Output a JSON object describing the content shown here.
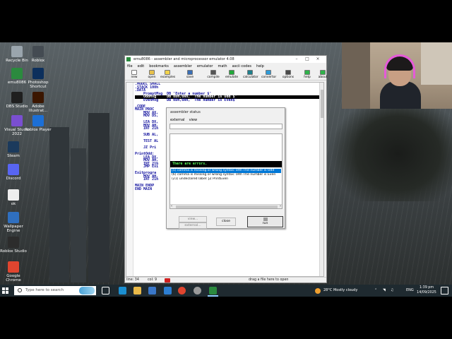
{
  "desktop_icons": [
    {
      "label": "Recycle Bin",
      "icon": "recycle-bin-icon",
      "color": "#9aa5ad"
    },
    {
      "label": "Roblox",
      "icon": "roblox-icon",
      "color": "#444b52"
    },
    {
      "label": "emu8086",
      "icon": "emu8086-icon",
      "color": "#2b8a3e"
    },
    {
      "label": "Photoshop Shortcut",
      "icon": "photoshop-icon",
      "color": "#0c2f5c"
    },
    {
      "label": "DBS Studio",
      "icon": "dbs-studio-icon",
      "color": "#1f1f1f"
    },
    {
      "label": "Adobe Illustrat...",
      "icon": "illustrator-icon",
      "color": "#3b1600"
    },
    {
      "label": "Visual Studio 2022",
      "icon": "visual-studio-icon",
      "color": "#7a4fd1"
    },
    {
      "label": "Roblox Player",
      "icon": "roblox-player-icon",
      "color": "#1c6fd6"
    },
    {
      "label": "Steam",
      "icon": "steam-icon",
      "color": "#1b3a5c"
    },
    {
      "label": "Discord",
      "icon": "discord-icon",
      "color": "#5865f2"
    },
    {
      "label": "ok",
      "icon": "file-icon",
      "color": "#eeeeee"
    },
    {
      "label": "Wallpaper Engine",
      "icon": "wallpaper-engine-icon",
      "color": "#2f6fbf"
    },
    {
      "label": "Roblox Studio",
      "icon": "roblox-studio-icon",
      "color": "#2c2c2c"
    },
    {
      "label": "Google Chrome",
      "icon": "chrome-icon",
      "color": "#e0452f"
    }
  ],
  "emulator": {
    "title": "emu8086 - assembler and microprocessor emulator 4.08",
    "menu": [
      "file",
      "edit",
      "bookmarks",
      "assembler",
      "emulator",
      "math",
      "ascii codes",
      "help"
    ],
    "toolbar": [
      {
        "label": "new",
        "icon": "new-file-icon",
        "color": "#ffffff"
      },
      {
        "label": "open",
        "icon": "open-folder-icon",
        "color": "#e8c14a"
      },
      {
        "label": "examples",
        "icon": "examples-icon",
        "color": "#f2d34b"
      },
      {
        "label": "save",
        "icon": "save-icon",
        "color": "#3a6fb5"
      },
      {
        "label": "compile",
        "icon": "compile-icon",
        "color": "#555555"
      },
      {
        "label": "emulate",
        "icon": "emulate-icon",
        "color": "#22a83a"
      },
      {
        "label": "calculator",
        "icon": "calculator-icon",
        "color": "#1f7f8c"
      },
      {
        "label": "convertor",
        "icon": "convertor-icon",
        "color": "#2f9bd8"
      },
      {
        "label": "options",
        "icon": "options-icon",
        "color": "#4a4a4a"
      },
      {
        "label": "help",
        "icon": "help-icon",
        "color": "#2fb24a"
      },
      {
        "label": "about",
        "icon": "about-icon",
        "color": "#2fb24a"
      }
    ],
    "code_lines": [
      ".MODEL SMALL",
      ".STACK 100h",
      ".DATA",
      "    PromptMsg  DB 'Enter a number $'",
      "    OddMsg     DB 0Dh,0Ah,' The number is Odd $'",
      "    EvenMsg    DB 0Dh,0Ah,' The number is Even$'",
      "",
      ".CODE",
      "MAIN PROC",
      "    MOV AX,",
      "    MOV DS,",
      "",
      "    LEA DX,",
      "    MOV AH,",
      "    INT 21h",
      "",
      "    SUB AL,",
      "",
      "    TEST AL",
      "",
      "    JZ Pri",
      "",
      "PrintOdd:",
      "    LEA DX,",
      "    MOV AH,",
      "    INT 21h",
      "    JMP Exi",
      "",
      "Exitprogra",
      "    MOV AH,",
      "    INT 21h",
      "",
      "MAIN ENDP",
      "END MAIN"
    ],
    "highlight_line": 4,
    "status": {
      "line": "line: 34",
      "col": "col: 9",
      "drop": "drag a file here to open"
    }
  },
  "dialog": {
    "title": "assembler status",
    "menu": [
      "external",
      "view"
    ],
    "error_header": "There are errors.",
    "errors": [
      "(5) comma is missing or wrong syntax: 0Ah   The number is Odd",
      "(6) comma is missing or wrong syntax: 0Ah   The number is Even",
      "(21) undeclared label: JZ PrintEven"
    ],
    "selected_error": 0,
    "buttons": {
      "view": "view...",
      "external": "external...",
      "close": "close",
      "run": "run"
    }
  },
  "taskbar": {
    "search_placeholder": "Type here to search",
    "weather": "28°C  Mostly cloudy",
    "lang": "ENG",
    "time": "1:39 pm",
    "date": "14/09/2025",
    "pinned": [
      {
        "icon": "task-view-icon",
        "color": "#ffffff"
      },
      {
        "icon": "edge-icon",
        "color": "#1b8fd1"
      },
      {
        "icon": "file-explorer-icon",
        "color": "#e9b949"
      },
      {
        "icon": "store-icon",
        "color": "#3a77c9"
      },
      {
        "icon": "mail-icon",
        "color": "#2d7fd3"
      },
      {
        "icon": "chrome-icon",
        "color": "#e0452f"
      },
      {
        "icon": "roblox-icon",
        "color": "#9a9a9a"
      },
      {
        "icon": "emu8086-icon",
        "color": "#2b8a3e"
      }
    ]
  }
}
